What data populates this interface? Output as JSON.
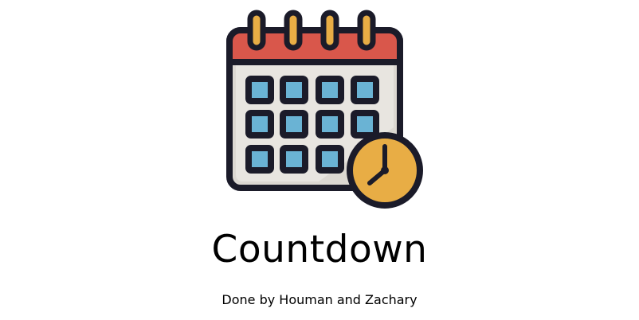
{
  "app": {
    "title": "Countdown",
    "credits": "Done by Houman and Zachary",
    "logo_icon": "calendar-clock-icon"
  },
  "colors": {
    "background": "#ffffff",
    "calendar_header": "#d9574b",
    "calendar_body": "#dcd8d2",
    "calendar_cell": "#6ab3d4",
    "ring": "#e8ad45",
    "clock_face": "#e8ad45",
    "outline": "#1b1b29",
    "text": "#000000"
  }
}
